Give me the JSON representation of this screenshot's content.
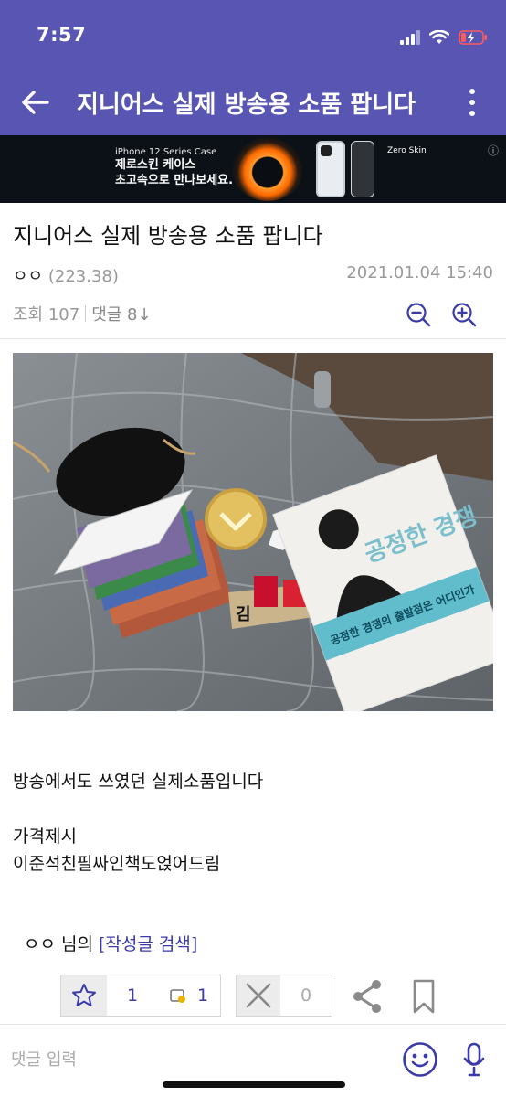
{
  "status_bar": {
    "time": "7:57"
  },
  "header": {
    "title": "지니어스 실제 방송용 소품 팝니다"
  },
  "banner": {
    "subtitle": "iPhone 12 Series Case",
    "line1": "제로스킨 케이스",
    "line2": "초고속으로 만나보세요.",
    "brand": "Zero Skin",
    "info_icon": "ⓘ"
  },
  "post": {
    "title": "지니어스 실제 방송용 소품 팝니다",
    "author": "ㅇㅇ",
    "author_ip": "(223.38)",
    "date": "2021.01.04 15:40",
    "views": "조회 107",
    "comments": "댓글 8↓",
    "body": [
      "방송에서도 쓰였던 실제소품입니다",
      "가격제시",
      "이준석친필싸인책도얹어드림"
    ],
    "photo_book_title": "공정한 경쟁",
    "photo_book_band": "공정한 경쟁의 출발점은 어디인가",
    "photo_nameplate": "김"
  },
  "search": {
    "author": "ㅇㅇ 님의",
    "link": "[작성글 검색]"
  },
  "actions": {
    "recommend_count": "1",
    "fixed_recommend_count": "1",
    "dislike_count": "0"
  },
  "comment_bar": {
    "placeholder": "댓글 입력"
  },
  "icons": [
    "back-arrow-icon",
    "more-vert-icon",
    "zoom-out-icon",
    "zoom-in-icon",
    "star-icon",
    "badge-icon",
    "x-icon",
    "share-icon",
    "bookmark-icon",
    "emoji-icon",
    "mic-icon"
  ],
  "colors": {
    "header_bg": "#5856b2",
    "link_blue": "#3a3aa8",
    "muted_gray": "#999999"
  }
}
